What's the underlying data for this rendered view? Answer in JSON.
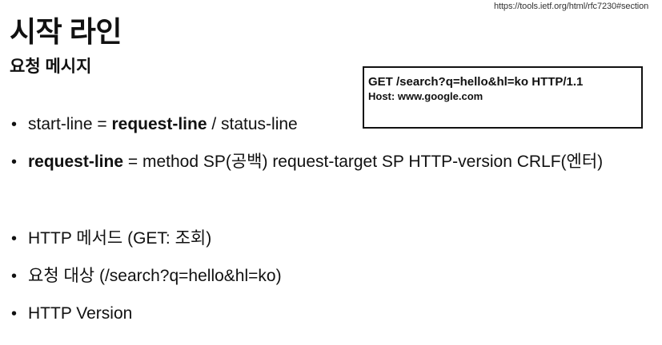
{
  "source_url": "https://tools.ietf.org/html/rfc7230#section",
  "title": "시작 라인",
  "subtitle": "요청 메시지",
  "http_example": {
    "line1": "GET /search?q=hello&hl=ko HTTP/1.1",
    "line2": "Host: www.google.com"
  },
  "bullets": {
    "b1": {
      "dot": "•",
      "part1": "start-line = ",
      "bold": "request-line",
      "part2": " / status-line"
    },
    "b2": {
      "dot": "•",
      "bold": "request-line",
      "part2": " = method SP(공백) request-target SP HTTP-version CRLF(엔터)"
    },
    "b3": {
      "dot": "•",
      "text": "HTTP 메서드 (GET: 조회)"
    },
    "b4": {
      "dot": "•",
      "text": "요청 대상 (/search?q=hello&hl=ko)"
    },
    "b5": {
      "dot": "•",
      "text": "HTTP Version"
    }
  }
}
